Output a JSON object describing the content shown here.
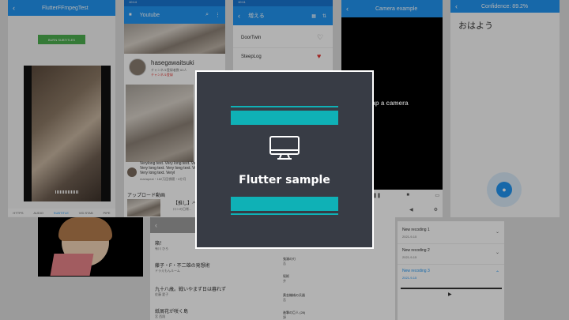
{
  "card": {
    "title": "Flutter sample",
    "icon": "monitor-icon",
    "accent": "#0fb1b6",
    "bg": "#383c45"
  },
  "ffmpeg": {
    "title": "FlutterFFmpegTest",
    "burn_button": "BURN SUBTITLES",
    "tabs": [
      "HTTPS",
      "AUDIO",
      "SUBTITLE",
      "VID.STAB",
      "PIPE"
    ]
  },
  "youtube": {
    "status_time": "10:14",
    "title": "Youtube",
    "channel_name": "hasegawaitsuki",
    "channel_sub": "チャンネル登録者数 60人",
    "subscribe": "チャンネル登録",
    "video_title": "Verylong text. Very long text. Very long text. Very long text. Very long text. Very long text. Very long text. Veryl",
    "video_meta": "mariapeal・182万回視聴・6か月",
    "section": "アップロード動画",
    "thumb_title": "【推し】ペ...",
    "thumb_sub": "ロンの日常..."
  },
  "list_app": {
    "status_time": "10:11",
    "title": "増える",
    "items": [
      {
        "name": "DoorTwin",
        "fav": false
      },
      {
        "name": "SteepLog",
        "fav": true
      }
    ]
  },
  "camera": {
    "title": "Camera example",
    "prompt": "Tap a camera"
  },
  "speech": {
    "title": "Confidence: 89.2%",
    "text": "おはよう"
  },
  "books": {
    "items": [
      {
        "title": "箱！",
        "author": "有川 ひろ"
      },
      {
        "title": "藤子・F・不二雄の発想術",
        "author": "ドラえもんルーム"
      },
      {
        "title": "九十八歳。戦いやまず日は暮れず",
        "author": "佐藤 愛子"
      },
      {
        "title": "紙屑花が咲く島",
        "author": "宮 西翔"
      }
    ],
    "side_items": [
      {
        "title": "鬼滅の刃",
        "author": "吾"
      },
      {
        "title": "呪術",
        "author": "芥"
      },
      {
        "title": "黄金機械の兵器",
        "author": "吾"
      },
      {
        "title": "進撃の巨人 (28)",
        "author": "諫"
      }
    ]
  },
  "recordings": {
    "items": [
      {
        "title": "New recoding 1",
        "date": "2021-9-15"
      },
      {
        "title": "New recoding 2",
        "date": "2021-9-15"
      },
      {
        "title": "New recoding 3",
        "date": "2021-9-15"
      }
    ]
  }
}
